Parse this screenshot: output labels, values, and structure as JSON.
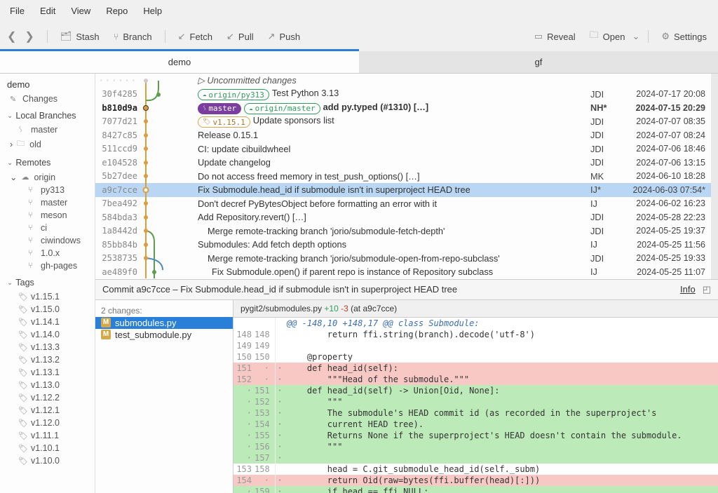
{
  "menu": {
    "file": "File",
    "edit": "Edit",
    "view": "View",
    "repo": "Repo",
    "help": "Help"
  },
  "toolbar": {
    "stash": "Stash",
    "branch": "Branch",
    "fetch": "Fetch",
    "pull": "Pull",
    "push": "Push",
    "reveal": "Reveal",
    "open": "Open",
    "settings": "Settings"
  },
  "tabs": {
    "demo": "demo",
    "gf": "gf"
  },
  "sidebar": {
    "repo": "demo",
    "changes": "Changes",
    "local_head": "Local Branches",
    "local": {
      "master": "master",
      "old": "old"
    },
    "remotes_head": "Remotes",
    "remotes": {
      "origin": "origin",
      "py313": "py313",
      "master": "master",
      "meson": "meson",
      "ci": "ci",
      "ciwindows": "ciwindows",
      "v10x": "1.0.x",
      "ghpages": "gh-pages"
    },
    "tags_head": "Tags",
    "tags": [
      "v1.15.1",
      "v1.15.0",
      "v1.14.1",
      "v1.14.0",
      "v1.13.3",
      "v1.13.2",
      "v1.13.1",
      "v1.13.0",
      "v1.12.2",
      "v1.12.1",
      "v1.12.0",
      "v1.11.1",
      "v1.10.1",
      "v1.10.0"
    ]
  },
  "commits": {
    "uncommitted": "Uncommitted changes",
    "rows": [
      {
        "hash": "30f4285",
        "msg": "Test Python 3.13",
        "pill_cloud": "origin/py313",
        "auth": "JDI",
        "date": "2024-07-17 20:08"
      },
      {
        "hash": "b810d9a",
        "msg": "add py.typed (#1310) […]",
        "pill_master": "master",
        "pill_cloud": "origin/master",
        "auth": "NH*",
        "date": "2024-07-15 20:29",
        "bold": true
      },
      {
        "hash": "7077d21",
        "msg": "Update sponsors list",
        "pill_tag": "v1.15.1",
        "auth": "JDI",
        "date": "2024-07-07 08:35"
      },
      {
        "hash": "8427c85",
        "msg": "Release 0.15.1",
        "auth": "JDI",
        "date": "2024-07-07 08:24"
      },
      {
        "hash": "511ccd9",
        "msg": "CI: update cibuildwheel",
        "auth": "JDI",
        "date": "2024-07-06 18:46"
      },
      {
        "hash": "e104528",
        "msg": "Update changelog",
        "auth": "JDI",
        "date": "2024-07-06 13:15"
      },
      {
        "hash": "5b27dee",
        "msg": "Do not access freed memory in test_push_options() […]",
        "auth": "MK",
        "date": "2024-06-10 18:28"
      },
      {
        "hash": "a9c7cce",
        "msg": "Fix Submodule.head_id if submodule isn't in superproject HEAD tree",
        "auth": "IJ*",
        "date": "2024-06-03 07:54*",
        "selected": true
      },
      {
        "hash": "7bea492",
        "msg": "Don't decref PyBytesObject before formatting an error with it",
        "auth": "IJ",
        "date": "2024-06-02 16:23"
      },
      {
        "hash": "584bda3",
        "msg": "Add Repository.revert() […]",
        "auth": "JDI",
        "date": "2024-05-28 22:23"
      },
      {
        "hash": "1a8442d",
        "msg": "Merge remote-tracking branch 'jorio/submodule-fetch-depth'",
        "auth": "JDI",
        "date": "2024-05-25 19:37",
        "indent": true
      },
      {
        "hash": "85bb84b",
        "msg": "Submodules: Add fetch depth options",
        "auth": "IJ",
        "date": "2024-05-25 11:56"
      },
      {
        "hash": "2538735",
        "msg": "Merge remote-tracking branch 'jorio/submodule-open-from-repo-subclass'",
        "auth": "JDI",
        "date": "2024-05-25 19:33",
        "indent": true
      },
      {
        "hash": "ae489f0",
        "msg": "Fix Submodule.open() if parent repo is instance of Repository subclass",
        "auth": "IJ",
        "date": "2024-05-25 11:07",
        "indent2": true
      }
    ]
  },
  "detail": {
    "header": "Commit a9c7cce – Fix Submodule.head_id if submodule isn't in superproject HEAD tree",
    "info": "Info",
    "changes_label": "2 changes:",
    "files": [
      {
        "badge": "M",
        "name": "submodules.py",
        "selected": true
      },
      {
        "badge": "M",
        "name": "test_submodule.py"
      }
    ],
    "diff_title": "pygit2/submodules.py",
    "diff_plus": "+10",
    "diff_minus": "-3",
    "diff_at": "(at a9c7cce)"
  },
  "diff_lines": [
    {
      "t": "hunk",
      "l": "",
      "r": "",
      "c": "@@ -148,10 +148,17 @@ class Submodule:"
    },
    {
      "t": "ctx",
      "l": "148",
      "r": "148",
      "c": "        return ffi.string(branch).decode('utf-8')"
    },
    {
      "t": "ctx",
      "l": "149",
      "r": "149",
      "c": ""
    },
    {
      "t": "ctx",
      "l": "150",
      "r": "150",
      "c": "    @property"
    },
    {
      "t": "del",
      "l": "151",
      "r": "",
      "c": "    def head_id(self):"
    },
    {
      "t": "del",
      "l": "152",
      "r": "",
      "c": "        \"\"\"Head of the submodule.\"\"\""
    },
    {
      "t": "add",
      "l": "",
      "r": "151",
      "c": "    def head_id(self) -> Union[Oid, None]:"
    },
    {
      "t": "add",
      "l": "",
      "r": "152",
      "c": "        \"\"\""
    },
    {
      "t": "add",
      "l": "",
      "r": "153",
      "c": "        The submodule's HEAD commit id (as recorded in the superproject's"
    },
    {
      "t": "add",
      "l": "",
      "r": "154",
      "c": "        current HEAD tree)."
    },
    {
      "t": "add",
      "l": "",
      "r": "155",
      "c": "        Returns None if the superproject's HEAD doesn't contain the submodule."
    },
    {
      "t": "add",
      "l": "",
      "r": "156",
      "c": "        \"\"\""
    },
    {
      "t": "add",
      "l": "",
      "r": "157",
      "c": ""
    },
    {
      "t": "ctx",
      "l": "153",
      "r": "158",
      "c": "        head = C.git_submodule_head_id(self._subm)"
    },
    {
      "t": "del",
      "l": "154",
      "r": "",
      "c": "        return Oid(raw=bytes(ffi.buffer(head)[:]))"
    },
    {
      "t": "add",
      "l": "",
      "r": "159",
      "c": "        if head == ffi.NULL:"
    }
  ]
}
